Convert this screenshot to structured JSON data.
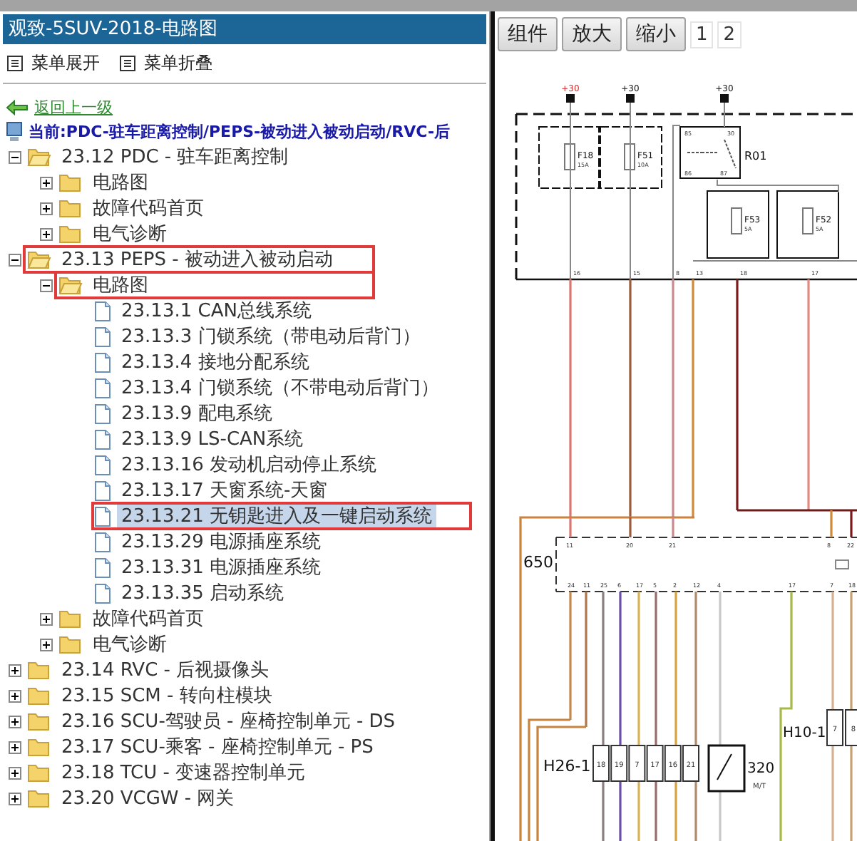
{
  "window": {
    "title": "观致-5SUV-2018-电路图"
  },
  "menu": [
    {
      "label": "菜单展开"
    },
    {
      "label": "菜单折叠"
    }
  ],
  "back_link": "返回上一级",
  "breadcrumb": "当前:PDC-驻车距离控制/PEPS-被动进入被动启动/RVC-后",
  "tree": [
    {
      "label": "23.12 PDC - 驻车距离控制",
      "kind": "folder",
      "expanded": true,
      "selected": false,
      "highlighted": false,
      "children": [
        {
          "label": "电路图",
          "kind": "folder",
          "expanded": false,
          "selected": false,
          "highlighted": false
        },
        {
          "label": "故障代码首页",
          "kind": "folder",
          "expanded": false,
          "selected": false,
          "highlighted": false
        },
        {
          "label": "电气诊断",
          "kind": "folder",
          "expanded": false,
          "selected": false,
          "highlighted": false
        }
      ]
    },
    {
      "label": "23.13 PEPS - 被动进入被动启动",
      "kind": "folder",
      "expanded": true,
      "selected": false,
      "highlighted": true,
      "children": [
        {
          "label": "电路图",
          "kind": "folder",
          "expanded": true,
          "selected": false,
          "highlighted": true,
          "children": [
            {
              "label": "23.13.1 CAN总线系统",
              "kind": "page",
              "selected": false,
              "highlighted": false
            },
            {
              "label": "23.13.3 门锁系统（带电动后背门）",
              "kind": "page",
              "selected": false,
              "highlighted": false
            },
            {
              "label": "23.13.4 接地分配系统",
              "kind": "page",
              "selected": false,
              "highlighted": false
            },
            {
              "label": "23.13.4 门锁系统（不带电动后背门）",
              "kind": "page",
              "selected": false,
              "highlighted": false
            },
            {
              "label": "23.13.9 配电系统",
              "kind": "page",
              "selected": false,
              "highlighted": false
            },
            {
              "label": "23.13.9 LS-CAN系统",
              "kind": "page",
              "selected": false,
              "highlighted": false
            },
            {
              "label": "23.13.16 发动机启动停止系统",
              "kind": "page",
              "selected": false,
              "highlighted": false
            },
            {
              "label": "23.13.17 天窗系统-天窗",
              "kind": "page",
              "selected": false,
              "highlighted": false
            },
            {
              "label": "23.13.21 无钥匙进入及一键启动系统",
              "kind": "page",
              "selected": true,
              "highlighted": true
            },
            {
              "label": "23.13.29 电源插座系统",
              "kind": "page",
              "selected": false,
              "highlighted": false
            },
            {
              "label": "23.13.31 电源插座系统",
              "kind": "page",
              "selected": false,
              "highlighted": false
            },
            {
              "label": "23.13.35 启动系统",
              "kind": "page",
              "selected": false,
              "highlighted": false
            }
          ]
        },
        {
          "label": "故障代码首页",
          "kind": "folder",
          "expanded": false,
          "selected": false,
          "highlighted": false
        },
        {
          "label": "电气诊断",
          "kind": "folder",
          "expanded": false,
          "selected": false,
          "highlighted": false
        }
      ]
    },
    {
      "label": "23.14 RVC - 后视摄像头",
      "kind": "folder",
      "expanded": false,
      "selected": false,
      "highlighted": false
    },
    {
      "label": "23.15 SCM - 转向柱模块",
      "kind": "folder",
      "expanded": false,
      "selected": false,
      "highlighted": false
    },
    {
      "label": "23.16 SCU-驾驶员 - 座椅控制单元 - DS",
      "kind": "folder",
      "expanded": false,
      "selected": false,
      "highlighted": false
    },
    {
      "label": "23.17 SCU-乘客 - 座椅控制单元 - PS",
      "kind": "folder",
      "expanded": false,
      "selected": false,
      "highlighted": false
    },
    {
      "label": "23.18 TCU - 变速器控制单元",
      "kind": "folder",
      "expanded": false,
      "selected": false,
      "highlighted": false
    },
    {
      "label": "23.20 VCGW - 网关",
      "kind": "folder",
      "expanded": false,
      "selected": false,
      "highlighted": false
    }
  ],
  "toolbar": [
    {
      "label": "组件"
    },
    {
      "label": "放大"
    },
    {
      "label": "缩小"
    }
  ],
  "pages": [
    "1",
    "2"
  ],
  "diagram": {
    "supplies": [
      "+30",
      "+30",
      "+30"
    ],
    "fuses": [
      {
        "name": "F18",
        "rating": "15A"
      },
      {
        "name": "F51",
        "rating": "10A"
      },
      {
        "name": "F53",
        "rating": "5A"
      },
      {
        "name": "F52",
        "rating": "5A"
      }
    ],
    "relay": {
      "name": "R01",
      "pins": [
        "85",
        "30",
        "86",
        "87"
      ]
    },
    "harness_pins": [
      "16",
      "15",
      "8",
      "13",
      "18",
      "17"
    ],
    "module": {
      "name": "650",
      "top_pins": [
        "11",
        "20",
        "21",
        "8",
        "22"
      ],
      "bottom_pins": [
        "24",
        "11",
        "25",
        "6",
        "17",
        "5",
        "2",
        "12",
        "4",
        "17",
        "7",
        "18"
      ]
    },
    "connector_a": {
      "name": "H26-1",
      "pins": [
        "18",
        "19",
        "7",
        "17",
        "16",
        "21"
      ]
    },
    "switch": {
      "name": "320",
      "note": "M/T"
    },
    "connector_b": {
      "name": "H10-1",
      "pins": [
        "7",
        "8"
      ]
    }
  }
}
